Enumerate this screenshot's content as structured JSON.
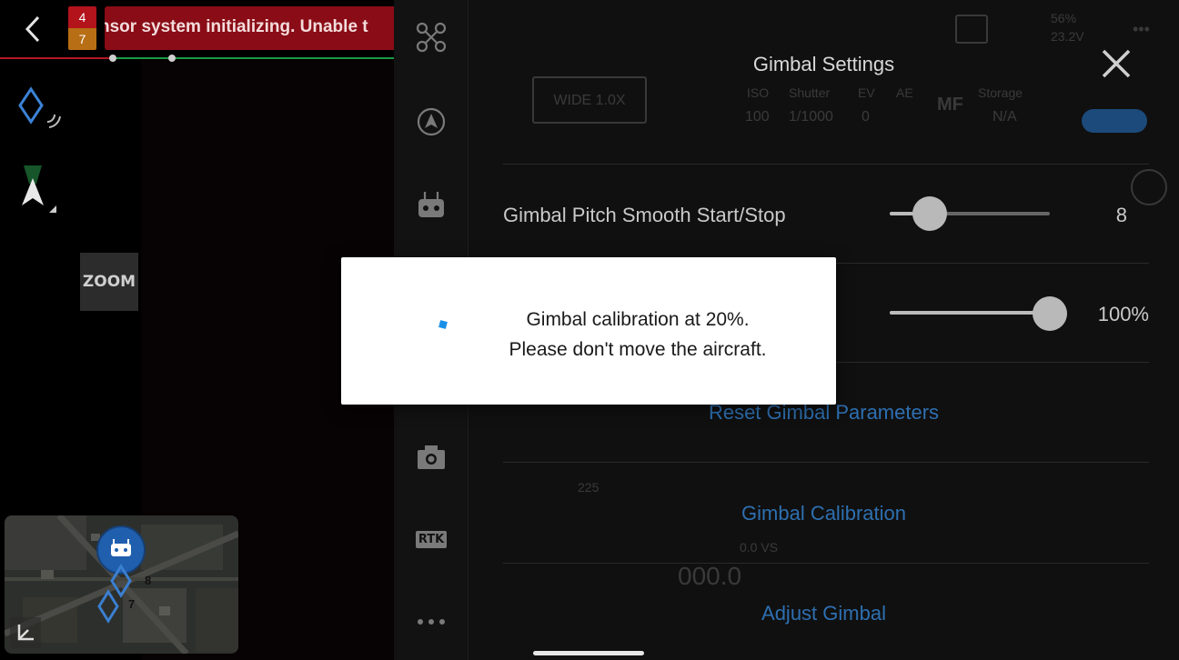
{
  "status": {
    "error_count": "4",
    "warning_count": "7",
    "banner_text": "nsor system initializing. Unable t"
  },
  "camera": {
    "zoom_label": "ZOOM"
  },
  "map": {
    "waypoint_labels": [
      "8",
      "7"
    ]
  },
  "toolbar": {
    "items": [
      "drone-icon",
      "flight-mode-icon",
      "remote-controller-icon",
      "camera-icon",
      "RTK",
      "more-icon"
    ],
    "rtk_label": "RTK"
  },
  "panel": {
    "title": "Gimbal Settings",
    "rows": [
      {
        "label": "Gimbal Pitch Smooth Start/Stop",
        "value": "8",
        "level": 0.25
      },
      {
        "label": "",
        "value": "100%",
        "level": 1.0
      }
    ],
    "reset_label": "Reset Gimbal Parameters",
    "calibration_label": "Gimbal Calibration",
    "adjust_label": "Adjust Gimbal"
  },
  "background_hud": {
    "camera_mode": "WIDE 1.0X",
    "iso_label": "ISO",
    "iso_value": "100",
    "shutter_label": "Shutter",
    "shutter_value": "1/1000",
    "ev_label": "EV",
    "ev_value": "0",
    "ae_label": "AE",
    "mf_label": "MF",
    "storage_label": "Storage",
    "storage_value": "N/A",
    "battery": "56%",
    "voltage": "23.2V",
    "speed": "0.0 VS",
    "altitude": "000.0",
    "heading": "225"
  },
  "dialog": {
    "line1": "Gimbal calibration at 20%.",
    "line2": "Please don't move the aircraft.",
    "progress": 0.2
  },
  "colors": {
    "accent_blue": "#2e6fb0",
    "error_red": "#b3131b",
    "warning_orange": "#b86e14",
    "spinner_blue": "#1a8fe8"
  }
}
